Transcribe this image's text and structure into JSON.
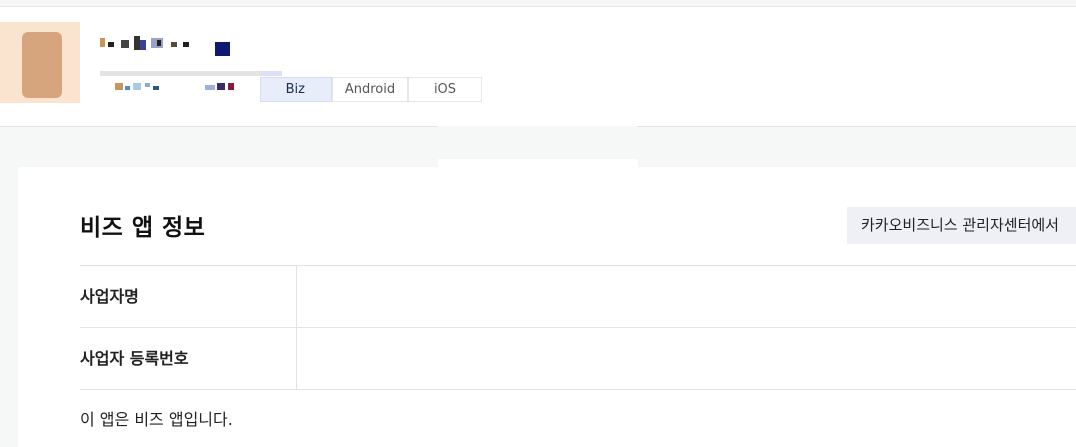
{
  "app": {
    "tabs": [
      {
        "label": "Biz",
        "active": true
      },
      {
        "label": "Android",
        "active": false
      },
      {
        "label": "iOS",
        "active": false
      }
    ]
  },
  "biz_section": {
    "title": "비즈 앱 정보",
    "bizcenter_button_label": "카카오비즈니스 관리자센터에서",
    "rows": [
      {
        "label": "사업자명",
        "value": ""
      },
      {
        "label": "사업자 등록번호",
        "value": ""
      }
    ],
    "note": "이 앱은 비즈 앱입니다."
  },
  "colors": {
    "active_tab_bg": "#e8edfa",
    "button_bg": "#eef0f6",
    "icon_bg": "#fbe4cf"
  }
}
